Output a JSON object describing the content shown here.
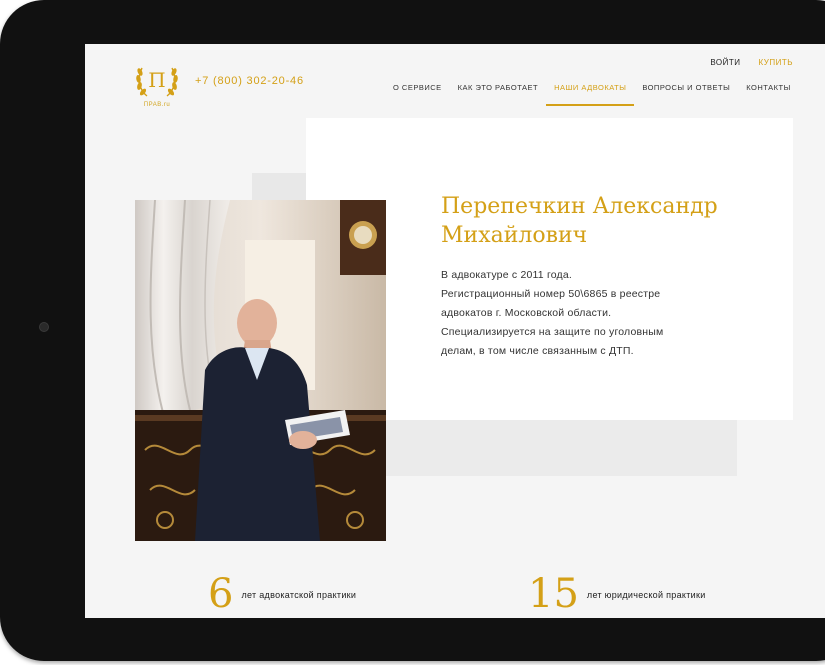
{
  "header": {
    "logo_letter": "П",
    "logo_sub": "ПРАВ.ru",
    "phone": "+7 (800) 302-20-46",
    "login": "ВОЙТИ",
    "buy": "КУПИТЬ"
  },
  "nav": {
    "items": [
      {
        "label": "О СЕРВИСЕ"
      },
      {
        "label": "КАК ЭТО РАБОТАЕТ"
      },
      {
        "label": "НАШИ АДВОКАТЫ"
      },
      {
        "label": "ВОПРОСЫ И ОТВЕТЫ"
      },
      {
        "label": "КОНТАКТЫ"
      }
    ],
    "active_index": 2
  },
  "lawyer": {
    "name_line1": "Перепечкин Александр",
    "name_line2": "Михайлович",
    "bio": [
      "В адвокатуре с 2011 года.",
      "Регистрационный номер 50\\6865 в реестре",
      "адвокатов г. Московской области.",
      "Специализируется на защите по уголовным",
      "делам, в том числе связанным с ДТП."
    ]
  },
  "stats": [
    {
      "value": "6",
      "label": "лет адвокатской практики"
    },
    {
      "value": "15",
      "label": "лет юридической практики"
    }
  ],
  "colors": {
    "accent": "#d4a017",
    "text": "#333333",
    "background": "#f5f5f5",
    "device": "#111111"
  }
}
